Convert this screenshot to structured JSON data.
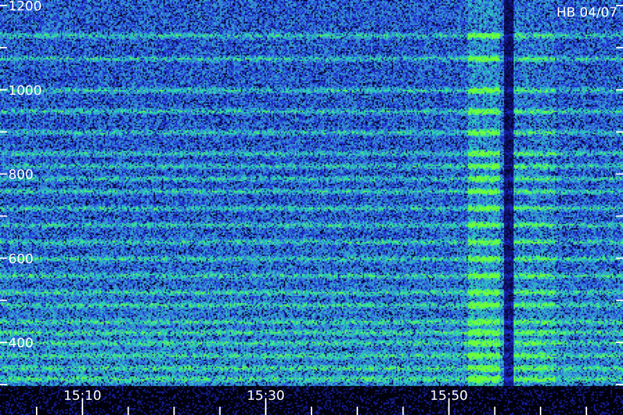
{
  "station_label": "HB 04/07",
  "chart_data": {
    "type": "heatmap",
    "title": "",
    "xlabel": "",
    "ylabel": "",
    "x_axis": {
      "unit": "time (HH:MM)",
      "range_minutes": [
        1,
        69
      ],
      "labeled_ticks": [
        {
          "label": "15:10",
          "value_min": 10
        },
        {
          "label": "15:30",
          "value_min": 30
        },
        {
          "label": "15:50",
          "value_min": 50
        }
      ],
      "minor_tick_step_min": 5
    },
    "y_axis": {
      "unit": "frequency",
      "range": [
        300,
        1200
      ],
      "labeled_ticks": [
        "400",
        "600",
        "800",
        "1000",
        "1200"
      ],
      "minor_tick_step": 100
    },
    "grid": false,
    "colormap": [
      "#000000",
      "#080a4a",
      "#1f2fd6",
      "#3a8ad8",
      "#27d6b8",
      "#6dff3a"
    ],
    "features": {
      "strong_burst_minutes": [
        52,
        55.5
      ],
      "weak_burst_minutes": [
        57,
        61.5
      ],
      "quiet_gap_minutes": [
        56,
        57
      ],
      "harmonic_bands": [
        1130,
        1075,
        1000,
        950,
        900,
        850,
        820,
        790,
        760,
        720,
        680,
        640,
        600,
        560,
        520,
        490,
        450,
        425,
        400,
        370,
        340,
        315
      ]
    }
  }
}
